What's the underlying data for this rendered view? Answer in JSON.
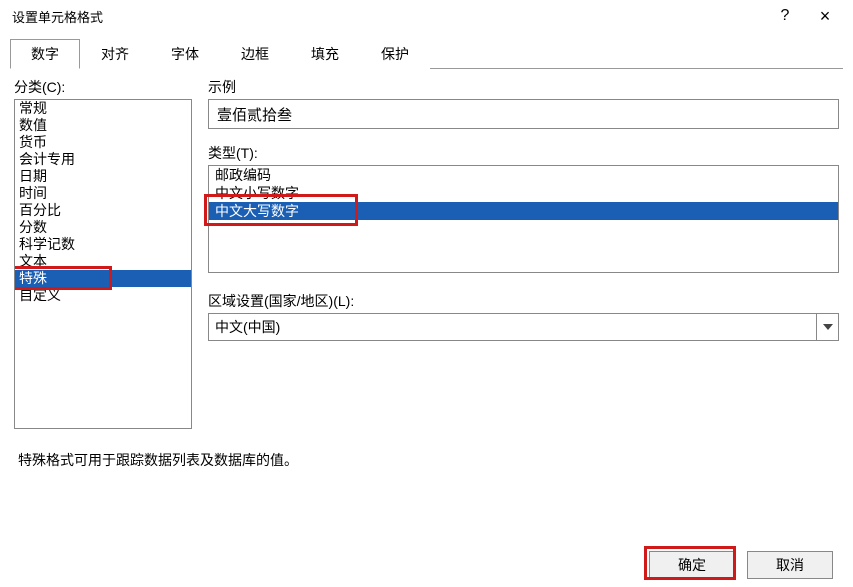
{
  "window": {
    "title": "设置单元格格式",
    "help_symbol": "?",
    "close_symbol": "×"
  },
  "tabs": {
    "items": [
      {
        "label": "数字",
        "active": true
      },
      {
        "label": "对齐",
        "active": false
      },
      {
        "label": "字体",
        "active": false
      },
      {
        "label": "边框",
        "active": false
      },
      {
        "label": "填充",
        "active": false
      },
      {
        "label": "保护",
        "active": false
      }
    ]
  },
  "category": {
    "label": "分类(C):",
    "items": [
      "常规",
      "数值",
      "货币",
      "会计专用",
      "日期",
      "时间",
      "百分比",
      "分数",
      "科学记数",
      "文本",
      "特殊",
      "自定义"
    ],
    "selected_index": 10
  },
  "sample": {
    "label": "示例",
    "value": "壹佰贰拾叁"
  },
  "type": {
    "label": "类型(T):",
    "items": [
      "邮政编码",
      "中文小写数字",
      "中文大写数字"
    ],
    "selected_index": 2
  },
  "locale": {
    "label": "区域设置(国家/地区)(L):",
    "value": "中文(中国)"
  },
  "description": "特殊格式可用于跟踪数据列表及数据库的值。",
  "buttons": {
    "ok": "确定",
    "cancel": "取消"
  }
}
